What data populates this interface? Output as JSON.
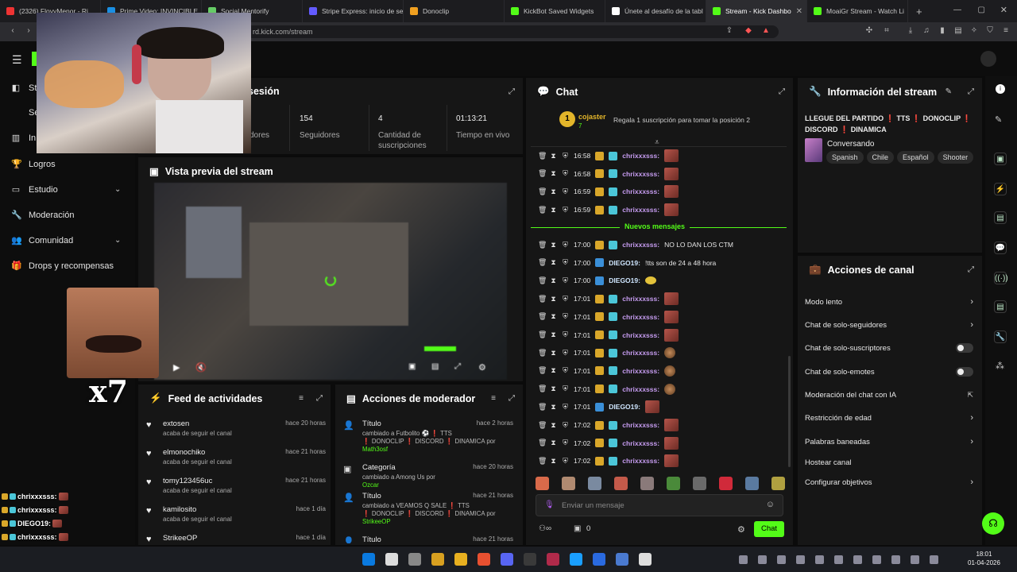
{
  "browser": {
    "tabs": [
      {
        "label": "(2326) FloyyMenor - Ri",
        "color": "#e33"
      },
      {
        "label": "Prime Video: INVINCIBLE",
        "color": "#1a8fe3"
      },
      {
        "label": "Social Mentorify",
        "color": "#6c6"
      },
      {
        "label": "Stripe Express: inicio de se",
        "color": "#635bff"
      },
      {
        "label": "Donoclip",
        "color": "#f0a020"
      },
      {
        "label": "KickBot Saved Widgets",
        "color": "#53fc18"
      },
      {
        "label": "Únete al desafío de la tabl",
        "color": "#fff"
      },
      {
        "label": "Stream - Kick Dashbo",
        "color": "#53fc18",
        "active": true
      },
      {
        "label": "MoaiGr Stream - Watch Li",
        "color": "#53fc18"
      }
    ],
    "url": "rd.kick.com/stream"
  },
  "sidebar": {
    "items": [
      {
        "label": "St",
        "icon": "stream-icon"
      },
      {
        "label": "Sen",
        "icon": ""
      },
      {
        "label": "In",
        "icon": "insights-icon"
      },
      {
        "label": "Logros",
        "icon": "trophy-icon"
      },
      {
        "label": "Estudio",
        "icon": "studio-icon",
        "chevron": true
      },
      {
        "label": "Moderación",
        "icon": "wrench-icon"
      },
      {
        "label": "Comunidad",
        "icon": "people-icon",
        "chevron": true
      },
      {
        "label": "Drops y recompensas",
        "icon": "gift-icon"
      }
    ]
  },
  "session": {
    "title": "sesión",
    "stats": [
      {
        "value": "",
        "label": "dores"
      },
      {
        "value": "154",
        "label": "Seguidores"
      },
      {
        "value": "4",
        "label": "Cantidad de suscripciones"
      },
      {
        "value": "01:13:21",
        "label": "Tiempo en vivo"
      }
    ]
  },
  "preview": {
    "title": "Vista previa del stream"
  },
  "feed": {
    "title": "Feed de actividades",
    "items": [
      {
        "name": "extosen",
        "sub": "acaba de seguir el canal",
        "time": "hace 20 horas"
      },
      {
        "name": "elmonochiko",
        "sub": "acaba de seguir el canal",
        "time": "hace 21 horas"
      },
      {
        "name": "tomy123456uc",
        "sub": "acaba de seguir el canal",
        "time": "hace 21 horas"
      },
      {
        "name": "kamilosito",
        "sub": "acaba de seguir el canal",
        "time": "hace 1 día"
      },
      {
        "name": "StrikeeOP",
        "sub": "",
        "time": "hace 1 día"
      }
    ]
  },
  "modactions": {
    "title": "Acciones de moderador",
    "items": [
      {
        "name": "Título",
        "line1": "cambiado a Futbolito ⚽ ❗ TTS",
        "line2": "❗ DONOCLIP ❗ DISCORD ❗ DINAMICA por",
        "by": "Math3osf",
        "time": "hace 2 horas"
      },
      {
        "name": "Categoría",
        "line1": "cambiado a Among Us por",
        "line2": "",
        "by": "Ozcar",
        "time": "hace 20 horas"
      },
      {
        "name": "Título",
        "line1": "cambiado a VEAMOS Q SALE ❗ TTS",
        "line2": "❗ DONOCLIP ❗ DISCORD ❗ DINAMICA por",
        "by": "StrikeeOP",
        "time": "hace 21 horas"
      },
      {
        "name": "Título",
        "line1": "",
        "line2": "",
        "by": "",
        "time": "hace 21 horas"
      }
    ]
  },
  "chat": {
    "title": "Chat",
    "pinned": {
      "user": "cojaster",
      "rank": "1",
      "count": "7",
      "text": "Regala 1 suscripción para tomar la posición 2"
    },
    "new_messages_label": "Nuevos mensajes",
    "before": [
      {
        "time": "16:58",
        "user": "chrixxxsss:",
        "emote": "emote-red"
      },
      {
        "time": "16:58",
        "user": "chrixxxsss:",
        "emote": "emote-red"
      },
      {
        "time": "16:59",
        "user": "chrixxxsss:",
        "emote": "emote-red"
      },
      {
        "time": "16:59",
        "user": "chrixxxsss:",
        "emote": "emote-red"
      }
    ],
    "after": [
      {
        "time": "17:00",
        "user": "chrixxxsss:",
        "text": "NO LO DAN LOS CTM",
        "kind": "c"
      },
      {
        "time": "17:00",
        "user": "DIEGO19:",
        "text": "!tts son de 24 a 48 hora",
        "kind": "d"
      },
      {
        "time": "17:00",
        "user": "DIEGO19:",
        "text": "",
        "kind": "d",
        "emote": "emote-yellow"
      },
      {
        "time": "17:01",
        "user": "chrixxxsss:",
        "text": "",
        "kind": "c",
        "emote": "emote-red"
      },
      {
        "time": "17:01",
        "user": "chrixxxsss:",
        "text": "",
        "kind": "c",
        "emote": "emote-red"
      },
      {
        "time": "17:01",
        "user": "chrixxxsss:",
        "text": "",
        "kind": "c",
        "emote": "emote-red"
      },
      {
        "time": "17:01",
        "user": "chrixxxsss:",
        "text": "",
        "kind": "c",
        "emote": "emote-face"
      },
      {
        "time": "17:01",
        "user": "chrixxxsss:",
        "text": "",
        "kind": "c",
        "emote": "emote-face"
      },
      {
        "time": "17:01",
        "user": "chrixxxsss:",
        "text": "",
        "kind": "c",
        "emote": "emote-face"
      },
      {
        "time": "17:01",
        "user": "DIEGO19:",
        "text": "",
        "kind": "d",
        "emote": "emote-red"
      },
      {
        "time": "17:02",
        "user": "chrixxxsss:",
        "text": "",
        "kind": "c",
        "emote": "emote-red"
      },
      {
        "time": "17:02",
        "user": "chrixxxsss:",
        "text": "",
        "kind": "c",
        "emote": "emote-red"
      },
      {
        "time": "17:02",
        "user": "chrixxxsss:",
        "text": "",
        "kind": "c",
        "emote": "emote-red"
      }
    ],
    "input_placeholder": "Enviar un mensaje",
    "count": "0",
    "send_label": "Chat"
  },
  "info": {
    "title": "Información del stream",
    "stream_title": "LLEGUE DEL PARTIDO ❗ TTS ❗ DONOCLIP ❗ DISCORD ❗ DINAMICA",
    "category": "Conversando",
    "tags": [
      "Spanish",
      "Chile",
      "Español",
      "Shooter"
    ]
  },
  "actions": {
    "title": "Acciones de canal",
    "items": [
      {
        "label": "Modo lento",
        "control": "chevron"
      },
      {
        "label": "Chat de solo-seguidores",
        "control": "chevron"
      },
      {
        "label": "Chat de solo-suscriptores",
        "control": "toggle"
      },
      {
        "label": "Chat de solo-emotes",
        "control": "toggle"
      },
      {
        "label": "Moderación del chat con IA",
        "control": "link"
      },
      {
        "label": "Restricción de edad",
        "control": "chevron"
      },
      {
        "label": "Palabras baneadas",
        "control": "chevron"
      },
      {
        "label": "Hostear canal",
        "control": "none"
      },
      {
        "label": "Configurar objetivos",
        "control": "chevron"
      }
    ]
  },
  "overlay": {
    "multiplier": "x7",
    "chat": [
      {
        "user": "chrixxxsss:"
      },
      {
        "user": "chrixxxsss:"
      },
      {
        "user": "DIEGO19:"
      },
      {
        "user": "chrixxxsss:"
      },
      {
        "user": "chrixxxsss:"
      },
      {
        "user": "chrixxxsss:"
      }
    ]
  },
  "taskbar": {
    "time": "18:01",
    "date": "01-04-2026"
  },
  "colors": {
    "accent": "#53fc18",
    "panel": "#161616",
    "bg": "#0b0b0b",
    "user": "#c69cf0"
  }
}
